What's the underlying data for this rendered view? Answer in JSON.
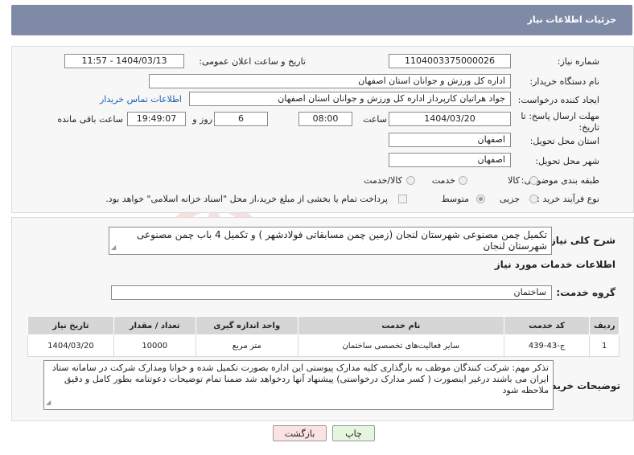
{
  "header": {
    "title": "جزئیات اطلاعات نیاز"
  },
  "fields": {
    "need_number_label": "شماره نیاز:",
    "need_number": "1104003375000026",
    "announce_label": "تاریخ و ساعت اعلان عمومی:",
    "announce_value": "1404/03/13 - 11:57",
    "buyer_org_label": "نام دستگاه خریدار:",
    "buyer_org": "اداره کل ورزش و جوانان استان اصفهان",
    "creator_label": "ایجاد کننده درخواست:",
    "creator": "جواد هراتیان کارپرداز اداره کل ورزش و جوانان استان اصفهان",
    "contact_link": "اطلاعات تماس خریدار",
    "deadline_label_1": "مهلت ارسال پاسخ: تا",
    "deadline_label_2": "تاریخ:",
    "deadline_date": "1404/03/20",
    "time_label": "ساعت",
    "deadline_time": "08:00",
    "days_value": "6",
    "days_label": "روز و",
    "remaining_time": "19:49:07",
    "remaining_label": "ساعت باقی مانده",
    "province_label": "استان محل تحویل:",
    "province": "اصفهان",
    "city_label": "شهر محل تحویل:",
    "city": "اصفهان",
    "category_label": "طبقه بندی موضوعی:",
    "category_options": [
      "کالا",
      "خدمت",
      "کالا/خدمت"
    ],
    "process_label": "نوع فرآیند خرید :",
    "process_options": [
      "جزیی",
      "متوسط"
    ],
    "payment_note": "پرداخت تمام یا بخشی از مبلغ خرید،از محل \"اسناد خزانه اسلامی\" خواهد بود."
  },
  "general": {
    "desc_label": "شرح کلی نیاز:",
    "desc_text": "تکمیل چمن مصنوعی شهرستان لنجان (زمین چمن مسابقاتی فولادشهر ) و تکمیل 4 باب چمن مصنوعی شهرستان لنجان",
    "services_heading": "اطلاعات خدمات مورد نیاز",
    "service_group_label": "گروه خدمت:",
    "service_group": "ساختمان"
  },
  "table": {
    "headers": [
      "ردیف",
      "کد خدمت",
      "نام خدمت",
      "واحد اندازه گیری",
      "تعداد / مقدار",
      "تاریخ نیاز"
    ],
    "rows": [
      [
        "1",
        "ج-43-439",
        "سایر فعالیت‌های تخصصی ساختمان",
        "متر مربع",
        "10000",
        "1404/03/20"
      ]
    ]
  },
  "notes": {
    "label": "توضیحات خریدار:",
    "text": "تذکر مهم: شرکت کنندگان موظف به بارگذاری کلیه مدارک پیوستی این اداره بصورت تکمیل شده و خوانا ومدارک شرکت در سامانه ستاد ایران می باشند درغیر اینصورت ( کسر مدارک درخواستی) پیشنهاد آنها ردخواهد شد ضمنا تمام توضیحات دعوتنامه بطور کامل و دقیق ملاحظه شود"
  },
  "buttons": {
    "print": "چاپ",
    "back": "بازگشت"
  },
  "colors": {
    "header_bg": "#7f8aa6",
    "print_bg": "#e6f5dd",
    "back_bg": "#fbe3e3",
    "link": "#1a5fb4"
  }
}
